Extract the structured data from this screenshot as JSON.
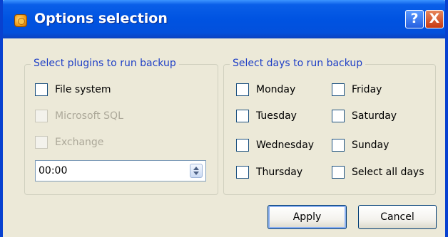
{
  "window": {
    "title": "Options selection",
    "help_glyph": "?",
    "close_glyph": "X"
  },
  "plugins": {
    "legend": "Select plugins to run backup",
    "items": [
      {
        "label": "File system",
        "checked": false,
        "enabled": true
      },
      {
        "label": "Microsoft SQL",
        "checked": false,
        "enabled": false
      },
      {
        "label": "Exchange",
        "checked": false,
        "enabled": false
      }
    ],
    "time_value": "00:00"
  },
  "days": {
    "legend": "Select days to run backup",
    "items": [
      {
        "label": "Monday",
        "checked": false
      },
      {
        "label": "Tuesday",
        "checked": false
      },
      {
        "label": "Wednesday",
        "checked": false
      },
      {
        "label": "Thursday",
        "checked": false
      },
      {
        "label": "Friday",
        "checked": false
      },
      {
        "label": "Saturday",
        "checked": false
      },
      {
        "label": "Sunday",
        "checked": false
      },
      {
        "label": "Select all days",
        "checked": false
      }
    ]
  },
  "buttons": {
    "apply": "Apply",
    "cancel": "Cancel"
  }
}
